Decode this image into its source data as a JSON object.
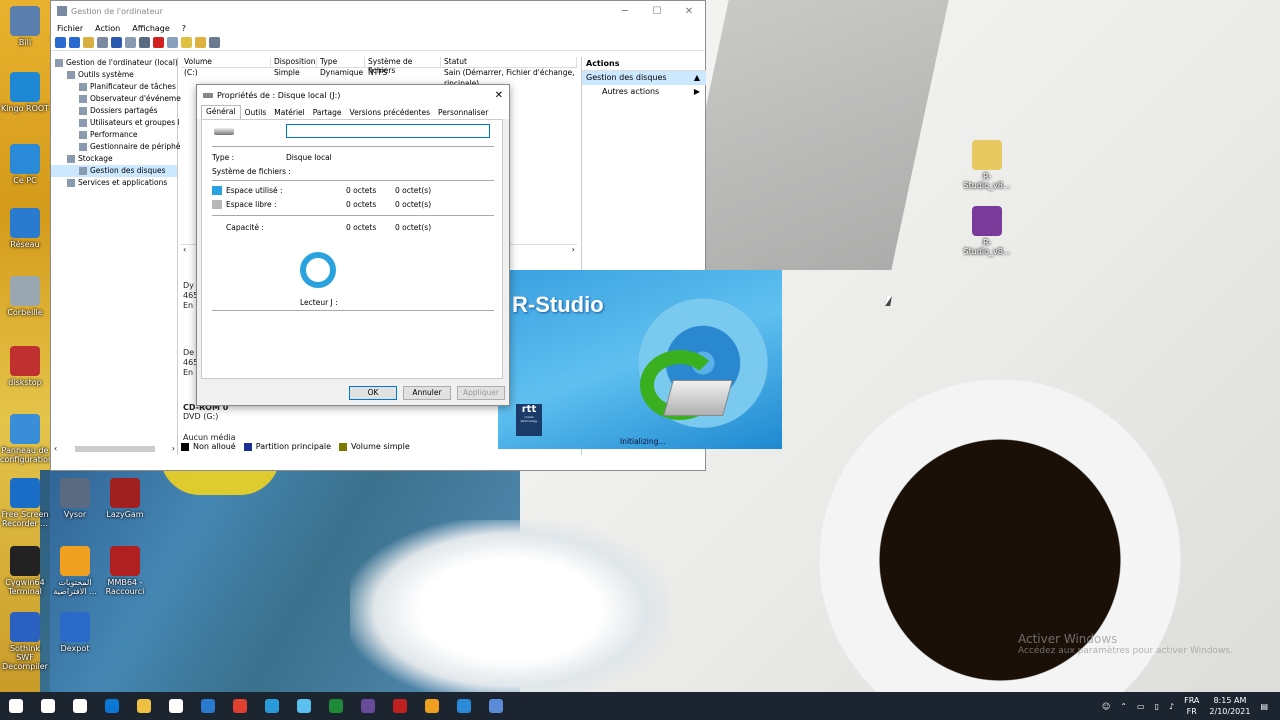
{
  "desktop_left": [
    {
      "label": "Bill",
      "color": "#5a7fae"
    },
    {
      "label": "Kingo ROOT",
      "color": "#1e88d4"
    },
    {
      "label": "Ce PC",
      "color": "#2a8ad8"
    },
    {
      "label": "Réseau",
      "color": "#2a7ad0"
    },
    {
      "label": "Corbeille",
      "color": "#9aa6b0"
    },
    {
      "label": "diskstop",
      "color": "#c03030"
    },
    {
      "label": "Panneau de configuration",
      "color": "#3a8ed8"
    },
    {
      "label": "Free Screen Recorder ...",
      "color": "#1a6ec8"
    },
    {
      "label": "Cygwin64 Terminal",
      "color": "#222"
    },
    {
      "label": "Sothink SWF Decompiler",
      "color": "#2a60c0"
    }
  ],
  "desktop_col2": [
    {
      "label": "Vysor",
      "color": "#5a6a80"
    },
    {
      "label": "المحتويات الافتراضية ...",
      "color": "#f0a020"
    },
    {
      "label": "Dexpot",
      "color": "#2a6ac8"
    }
  ],
  "desktop_col3": [
    {
      "label": "LazyGam",
      "color": "#a02020"
    },
    {
      "label": "MMB64 - Raccourci",
      "color": "#b02020"
    }
  ],
  "desktop_right": [
    {
      "label": "R-Studio_v8...",
      "color": "#e8c860"
    },
    {
      "label": "R-Studio_v8...",
      "color": "#7a3a9a"
    }
  ],
  "window": {
    "title": "Gestion de l'ordinateur",
    "menu": [
      "Fichier",
      "Action",
      "Affichage",
      "?"
    ],
    "tree": [
      {
        "label": "Gestion de l'ordinateur (local)",
        "indent": 0
      },
      {
        "label": "Outils système",
        "indent": 1
      },
      {
        "label": "Planificateur de tâches",
        "indent": 2
      },
      {
        "label": "Observateur d'événeme",
        "indent": 2
      },
      {
        "label": "Dossiers partagés",
        "indent": 2
      },
      {
        "label": "Utilisateurs et groupes l",
        "indent": 2
      },
      {
        "label": "Performance",
        "indent": 2
      },
      {
        "label": "Gestionnaire de périphé",
        "indent": 2
      },
      {
        "label": "Stockage",
        "indent": 1
      },
      {
        "label": "Gestion des disques",
        "indent": 2
      },
      {
        "label": "Services et applications",
        "indent": 1
      }
    ],
    "columns": [
      "Volume",
      "Disposition",
      "Type",
      "Système de fichiers",
      "Statut"
    ],
    "rows": [
      [
        "(C:)",
        "Simple",
        "Dynamique",
        "NTFS",
        "Sain (Démarrer, Fichier d'échange, Vi"
      ],
      [
        "",
        "",
        "",
        "",
        "rincipale)"
      ],
      [
        "",
        "",
        "",
        "",
        "isque)"
      ],
      [
        "",
        "",
        "",
        "",
        "rincipale)"
      ],
      [
        "",
        "",
        "",
        "",
        "isque)"
      ],
      [
        "",
        "",
        "",
        "",
        "rant un risque)"
      ]
    ],
    "actions_title": "Actions",
    "actions_selected": "Gestion des disques",
    "actions_more": "Autres actions",
    "disk_lines": [
      "Dy",
      "465",
      "En",
      "De",
      "465",
      "En"
    ],
    "cdrom_label": "CD-ROM 0",
    "dvd": "DVD (G:)",
    "no_media": "Aucun média",
    "legend": [
      {
        "label": "Non alloué",
        "color": "#000"
      },
      {
        "label": "Partition principale",
        "color": "#1b2f96"
      },
      {
        "label": "Volume simple",
        "color": "#7a7a00"
      }
    ]
  },
  "dialog": {
    "title": "Propriétés de : Disque local (J:)",
    "tabs": [
      "Général",
      "Outils",
      "Matériel",
      "Partage",
      "Versions précédentes",
      "Personnaliser"
    ],
    "name_value": "",
    "type_label": "Type :",
    "type_value": "Disque local",
    "fs_label": "Système de fichiers :",
    "used_label": "Espace utilisé :",
    "used_bytes": "0 octets",
    "used_size": "0 octet(s)",
    "free_label": "Espace libre :",
    "free_bytes": "0 octets",
    "free_size": "0 octet(s)",
    "cap_label": "Capacité :",
    "cap_bytes": "0 octets",
    "cap_size": "0 octet(s)",
    "drive_label": "Lecteur J :",
    "ok": "OK",
    "cancel": "Annuler",
    "apply": "Appliquer",
    "used_color": "#2aa2e0",
    "free_color": "#b8b8b8"
  },
  "splash": {
    "title": "R-Studio",
    "logo": "rtt",
    "logo_sub": "r-tools technology",
    "status": "Initializing..."
  },
  "watermark": {
    "line1": "Activer Windows",
    "line2": "Accédez aux paramètres pour activer Windows."
  },
  "taskbar": {
    "icons": [
      "#fff",
      "#fff",
      "#fff",
      "#0a78d4",
      "#f0c040",
      "#fff",
      "#2a7ad0",
      "#e04030",
      "#2a9ad8",
      "#5ac0f0",
      "#1e8a3a",
      "#6a4a9a",
      "#c02020",
      "#f0a020",
      "#2a8ad8",
      "#5a8ad8"
    ],
    "lang1": "FRA",
    "lang2": "FR",
    "time": "8:15 AM",
    "date": "2/10/2021"
  }
}
